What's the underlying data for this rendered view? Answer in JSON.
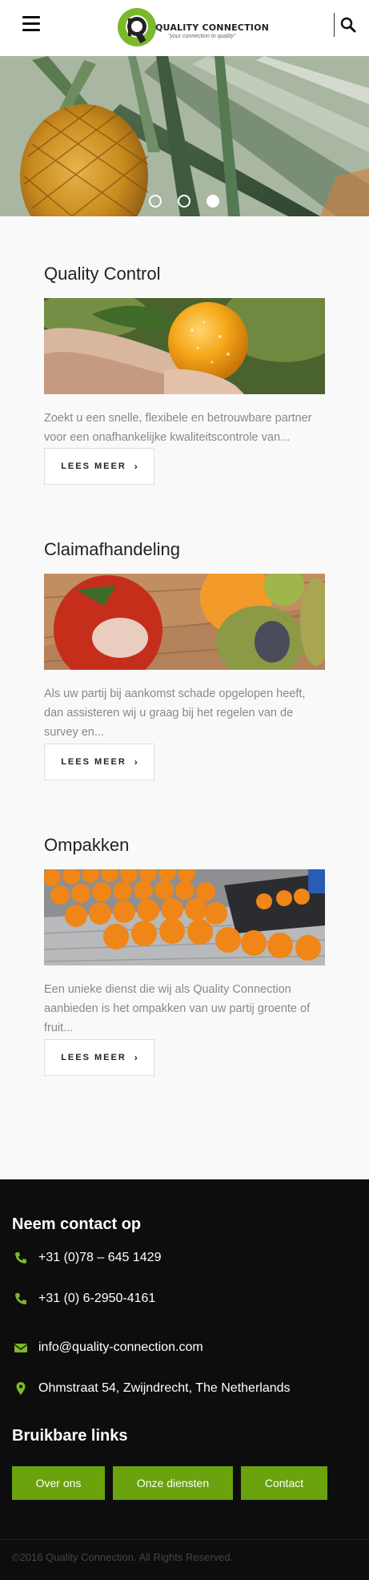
{
  "header": {
    "brand_name": "QUALITY CONNECTION",
    "tagline": "\"your connection to quality\""
  },
  "hero": {
    "slide_count": 3,
    "active_slide": 3
  },
  "services": [
    {
      "title": "Quality Control",
      "description": "Zoekt u een snelle, flexibele en betrouwbare partner voor een onafhankelijke kwaliteitscontrole van...",
      "button_label": "LEES MEER"
    },
    {
      "title": "Claimafhandeling",
      "description": "Als uw partij bij aankomst schade opgelopen heeft, dan assisteren wij u graag bij het regelen van de survey en...",
      "button_label": "LEES MEER"
    },
    {
      "title": "Ompakken",
      "description": "Een unieke dienst die wij als Quality Connection aanbieden is het ompakken van uw partij groente of fruit...",
      "button_label": "LEES MEER"
    }
  ],
  "footer": {
    "contact_heading": "Neem contact op",
    "phone_1": "+31 (0)78 – 645 1429",
    "phone_2": "+31 (0) 6-2950-4161",
    "email": "info@quality-connection.com",
    "address": "Ohmstraat 54, Zwijndrecht, The Netherlands",
    "links_heading": "Bruikbare links",
    "links": [
      "Over ons",
      "Onze diensten",
      "Contact"
    ],
    "copyright": "©2016 Quality Connection. All Rights Reserved."
  },
  "colors": {
    "accent_green": "#7ab929",
    "button_green": "#6aa30e",
    "footer_bg": "#0d0d0d"
  }
}
